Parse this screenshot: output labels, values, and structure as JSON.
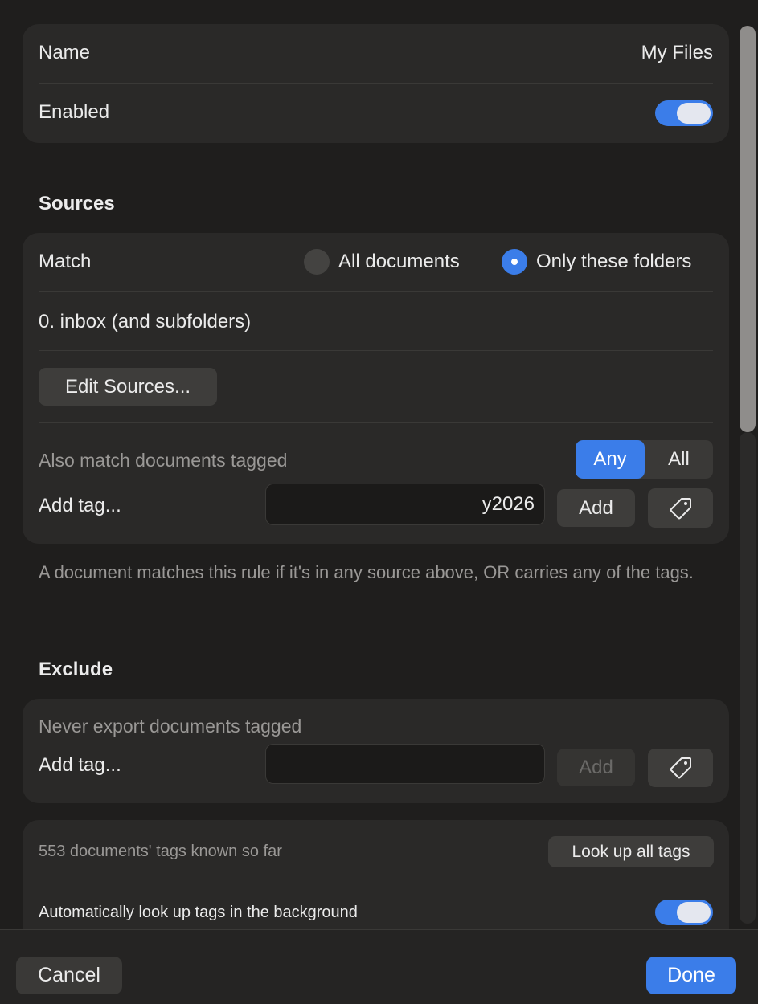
{
  "general": {
    "name_label": "Name",
    "name_value": "My Files",
    "enabled_label": "Enabled",
    "enabled_on": true
  },
  "sources": {
    "title": "Sources",
    "match_label": "Match",
    "options": [
      "All documents",
      "Only these folders"
    ],
    "selected_option": "Only these folders",
    "folder_item": "0. inbox (and subfolders)",
    "edit_button": "Edit Sources...",
    "also_match_label": "Also match documents tagged",
    "segment": [
      "Any",
      "All"
    ],
    "segment_selected": "Any",
    "add_tag_label": "Add tag...",
    "tag_input_value": "y2026",
    "add_button": "Add",
    "tag_icon": "tag-icon"
  },
  "explanation": "A document matches this rule if it's in any source above, OR carries any of the tags.",
  "exclude": {
    "title": "Exclude",
    "never_export_label": "Never export documents tagged",
    "add_tag_label": "Add tag...",
    "tag_input_value": "",
    "add_button": "Add",
    "tag_icon": "tag-icon"
  },
  "tags_info": {
    "known_text": "553 documents' tags known so far",
    "lookup_button": "Look up all tags",
    "auto_lookup_label": "Automatically look up tags in the background",
    "auto_lookup_on": true
  },
  "footer": {
    "cancel": "Cancel",
    "done": "Done"
  },
  "colors": {
    "accent": "#3b7de9",
    "background": "#1f1e1d",
    "card": "#2a2928"
  }
}
